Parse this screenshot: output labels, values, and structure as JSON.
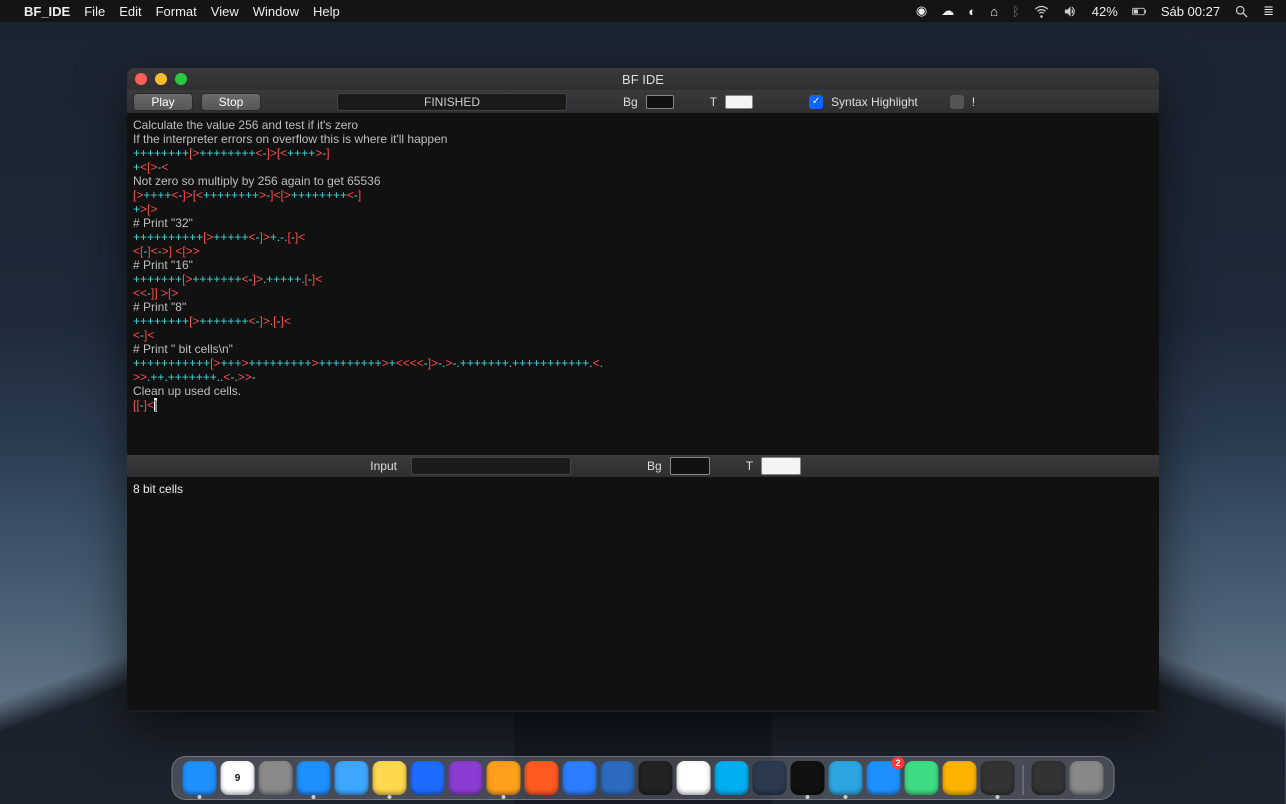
{
  "menubar": {
    "appname": "BF_IDE",
    "items": [
      "File",
      "Edit",
      "Format",
      "View",
      "Window",
      "Help"
    ],
    "battery_pct": "42%",
    "date_time": "Sáb 00:27"
  },
  "window": {
    "title": "BF IDE",
    "play_label": "Play",
    "stop_label": "Stop",
    "status": "FINISHED",
    "bg_label": "Bg",
    "t_label": "T",
    "syntax_label": "Syntax Highlight",
    "bang_label": "!",
    "input_label": "Input",
    "bg2_label": "Bg",
    "t2_label": "T"
  },
  "code": {
    "l1": "Calculate the value 256 and test if it's zero",
    "l2": "If the interpreter errors on overflow this is where it'll happen",
    "l4_comment": "    Not zero so multiply by 256 again to get 65536",
    "l7_comment": "        # Print \"32\"",
    "l10_comment": "        # Print \"16\"",
    "l13_comment": "    # Print \"8\"",
    "l15_comment": "# Print \" bit cells\\n\"",
    "l18_comment": "Clean up used cells."
  },
  "output_text": "8 bit cells",
  "dock": {
    "items": [
      {
        "name": "finder",
        "label": "",
        "bg": "#1e90ff"
      },
      {
        "name": "calendar",
        "label": "9",
        "bg": "#ffffff",
        "fg": "#111"
      },
      {
        "name": "launchpad",
        "label": "",
        "bg": "#8a8a8a"
      },
      {
        "name": "safari",
        "label": "",
        "bg": "#1e8fff"
      },
      {
        "name": "mail",
        "label": "",
        "bg": "#3da7ff"
      },
      {
        "name": "notes",
        "label": "",
        "bg": "#ffd84d",
        "fg": "#111"
      },
      {
        "name": "keynote",
        "label": "",
        "bg": "#1e6cff"
      },
      {
        "name": "firefox",
        "label": "",
        "bg": "#8b3dd1"
      },
      {
        "name": "sublime",
        "label": "",
        "bg": "#ff9f1a"
      },
      {
        "name": "brave",
        "label": "",
        "bg": "#ff5a1f"
      },
      {
        "name": "xcode",
        "label": "",
        "bg": "#2c7dff"
      },
      {
        "name": "vscode",
        "label": "",
        "bg": "#2a6bbf"
      },
      {
        "name": "activity",
        "label": "",
        "bg": "#222"
      },
      {
        "name": "clock",
        "label": "",
        "bg": "#fff"
      },
      {
        "name": "skype",
        "label": "",
        "bg": "#00aff0"
      },
      {
        "name": "quicktime",
        "label": "",
        "bg": "#2b3a4f"
      },
      {
        "name": "terminal",
        "label": "",
        "bg": "#111"
      },
      {
        "name": "telegram",
        "label": "",
        "bg": "#2ca5e0"
      },
      {
        "name": "appstore",
        "label": "",
        "bg": "#1e90ff",
        "badge": "2"
      },
      {
        "name": "android-studio",
        "label": "",
        "bg": "#3ddc84"
      },
      {
        "name": "sketch",
        "label": "",
        "bg": "#fdb300"
      },
      {
        "name": "bfide",
        "label": "",
        "bg": "#333"
      }
    ],
    "right": [
      {
        "name": "doc",
        "label": "",
        "bg": "#333"
      },
      {
        "name": "trash",
        "label": "",
        "bg": "#888"
      }
    ]
  }
}
